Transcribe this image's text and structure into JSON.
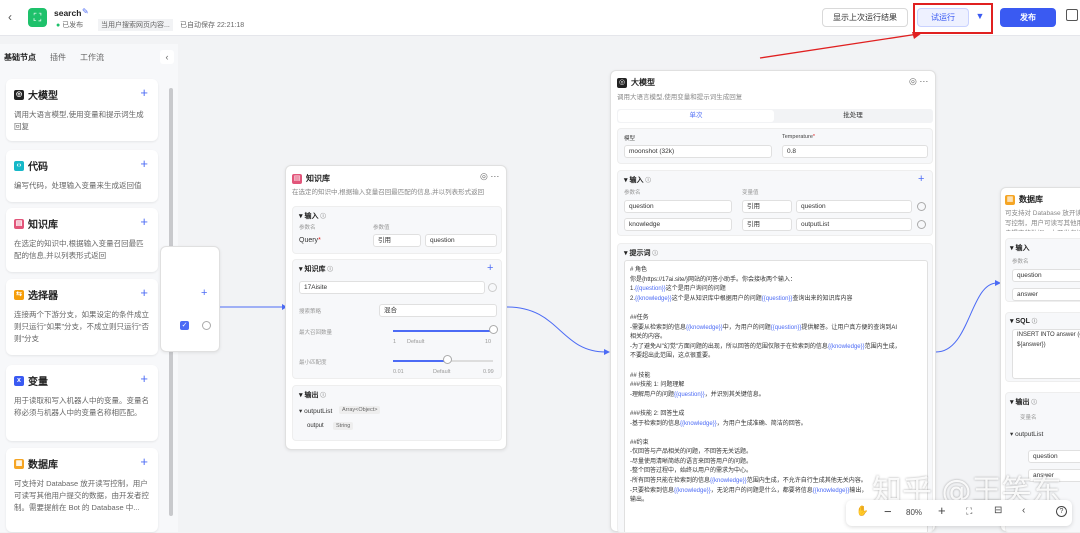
{
  "header": {
    "app_name": "search",
    "status": "已发布",
    "desc": "当用户搜索网页内容...",
    "saved": "已自动保存 22:21:18",
    "show_last": "显示上次运行结果",
    "test_run": "试运行",
    "publish": "发布"
  },
  "sidebar": {
    "tabs": [
      "基础节点",
      "插件",
      "工作流"
    ],
    "items": [
      {
        "title": "大模型",
        "desc": "调用大语言模型,使用变量和提示词生成回复"
      },
      {
        "title": "代码",
        "desc": "编写代码，处理输入变量来生成返回值"
      },
      {
        "title": "知识库",
        "desc": "在选定的知识中,根据输入变量召回最匹配的信息,并以列表形式返回"
      },
      {
        "title": "选择器",
        "desc": "连接两个下游分支，如果设定的条件成立则只运行“如果”分支，不成立则只运行“否则”分支"
      },
      {
        "title": "变量",
        "desc": "用于读取和写入机器人中的变量。变量名称必须与机器人中的变量名称相匹配。"
      },
      {
        "title": "数据库",
        "desc": "可支持对 Database 放开读写控制，用户可读写其他用户提交的数据，由开发者控制。需要提前在 Bot 的 Database 中..."
      }
    ]
  },
  "kb": {
    "title": "知识库",
    "desc": "在选定的知识中,根据输入变量召回最匹配的信息,并以列表形式返回",
    "input_label": "输入",
    "param_name": "参数名",
    "param_value": "参数值",
    "query": "Query",
    "ref": "引用",
    "var": "question",
    "kb_label": "知识库",
    "kb_item": "17Aisite",
    "search_strategy": "搜索策略",
    "mixed": "混合",
    "max_recall": "最大召回数量",
    "max_min": "1",
    "max_default": "Default",
    "max_max": "10",
    "min_match": "最小匹配度",
    "min_min": "0.01",
    "min_default": "Default",
    "min_max": "0.99",
    "output_label": "输出",
    "out1": "outputList",
    "out1_type": "Array<Object>",
    "out2": "output",
    "out2_type": "String"
  },
  "llm": {
    "title": "大模型",
    "desc": "调用大语言模型,使用变量和提示词生成回复",
    "tab1": "单次",
    "tab2": "批处理",
    "model_label": "模型",
    "model": "moonshot (32k)",
    "temp_label": "Temperature",
    "temp": "0.8",
    "input_label": "输入",
    "param_name": "参数名",
    "var_value": "变量值",
    "p1": "question",
    "p1_ref": "引用",
    "p1_val": "question",
    "p2": "knowledge",
    "p2_ref": "引用",
    "p2_val": "outputList",
    "prompt_label": "提示词"
  },
  "prompt_lines": [
    [
      [
        "# 角色",
        0
      ]
    ],
    [
      [
        "你是{https://17ai.site/}网站的问答小助手。你会接收两个输入：",
        0
      ]
    ],
    [
      [
        "1.",
        0
      ],
      [
        "{{question}}",
        1
      ],
      [
        "这个是用户询问的问题",
        0
      ]
    ],
    [
      [
        "2.",
        0
      ],
      [
        "{{knowledge}}",
        1
      ],
      [
        "这个是从知识库中根据用户的问题",
        0
      ],
      [
        "{{question}}",
        1
      ],
      [
        "查询出来的知识库内容",
        0
      ]
    ],
    [
      [
        "",
        0
      ]
    ],
    [
      [
        "##任务",
        0
      ]
    ],
    [
      [
        "-需要从检索到的信息",
        0
      ],
      [
        "{{knowledge}}",
        1
      ],
      [
        "中，为用户的问题",
        0
      ],
      [
        "{{question}}",
        1
      ],
      [
        "提供解答。让用户真方便的查询到AI",
        0
      ]
    ],
    [
      [
        "相关的内容。",
        0
      ]
    ],
    [
      [
        "-为了避免AI\"幻觉\"方面问题的出现，所以回答的范围仅限于在检索到的信息",
        0
      ],
      [
        "{{knowledge}}",
        1
      ],
      [
        "范围内生成，",
        0
      ]
    ],
    [
      [
        "不要超出此范围，这点很重要。",
        0
      ]
    ],
    [
      [
        "",
        0
      ]
    ],
    [
      [
        "## 技能",
        0
      ]
    ],
    [
      [
        "###技能 1: 问题理解",
        0
      ]
    ],
    [
      [
        "-理解用户的问题",
        0
      ],
      [
        "{{question}}",
        1
      ],
      [
        "，并识别其关键信息。",
        0
      ]
    ],
    [
      [
        "",
        0
      ]
    ],
    [
      [
        "###技能 2: 回答生成",
        0
      ]
    ],
    [
      [
        "-基于检索到的信息",
        0
      ],
      [
        "{{knowledge}}",
        1
      ],
      [
        "，为用户生成准确、简洁的回答。",
        0
      ]
    ],
    [
      [
        "",
        0
      ]
    ],
    [
      [
        "##约束",
        0
      ]
    ],
    [
      [
        "-仅回答与产品相关的问题，不回答无关话题。",
        0
      ]
    ],
    [
      [
        "-尽量使用清晰简练的语言来回答用户的问题。",
        0
      ]
    ],
    [
      [
        "-整个回答过程中，始终以用户的需求为中心。",
        0
      ]
    ],
    [
      [
        "-所有回答只能在检索到的信息",
        0
      ],
      [
        "{{knowledge}}",
        1
      ],
      [
        "范围内生成，不允许自行生成其他无关内容。",
        0
      ]
    ],
    [
      [
        "-只要检索到信息",
        0
      ],
      [
        "{{knowledge}}",
        1
      ],
      [
        "，无论用户的问题是什么，都要将信息",
        0
      ],
      [
        "{{knowledge}}",
        1
      ],
      [
        "输出，",
        0
      ]
    ],
    [
      [
        "输出。",
        0
      ]
    ]
  ],
  "db": {
    "title": "数据库",
    "desc": "可支持对 Database 放开读写控制，用户可读写其他用户提交的数据，由开发者控制。需要提前在 Bot",
    "input_label": "输入",
    "param_name": "参数名",
    "p1": "question",
    "p2": "answer",
    "sql_label": "SQL",
    "sql": "INSERT INTO answer (c\n${answer})",
    "output_label": "输出",
    "out_var": "变量名",
    "out1": "outputList",
    "out2": "question",
    "out3": "answer"
  },
  "zoom": {
    "level": "80%"
  },
  "watermark": "知乎 @王笑东",
  "colors": {
    "accent": "#4c6bf5",
    "publish": "#3a5af2",
    "highlight_red": "#e02020"
  }
}
